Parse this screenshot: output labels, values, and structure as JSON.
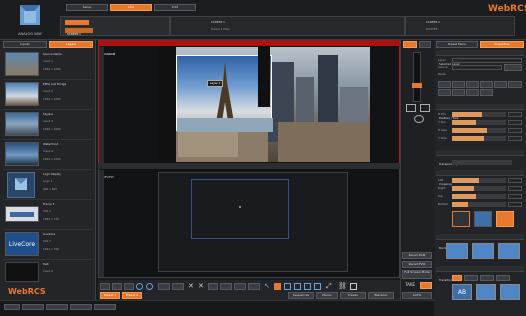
{
  "topbar": {
    "tabs": [
      {
        "label": "Setup"
      },
      {
        "label": "Live"
      },
      {
        "label": "Edit"
      }
    ],
    "left_items": [
      {
        "label": "SCREEN 1"
      },
      {
        "label": "MONITORING"
      }
    ],
    "mid_items": [
      {
        "label": "SCREEN 1"
      },
      {
        "label": "Preset 1 Main"
      }
    ],
    "right_items": [
      {
        "label": "SCREEN 2"
      },
      {
        "label": "MASTER"
      }
    ],
    "brand": "WebRCS",
    "logo": "ANALOG WAY"
  },
  "left": {
    "tabs": [
      {
        "label": "Inputs"
      },
      {
        "label": "Layers"
      }
    ],
    "items": [
      {
        "title": "Source Name",
        "sub": "Input 1",
        "res": "1920 x 1080"
      },
      {
        "title": "Eiffel and Bridge",
        "sub": "Input 2",
        "res": "1920 x 1080"
      },
      {
        "title": "Skyline",
        "sub": "Input 3",
        "res": "1920 x 1080"
      },
      {
        "title": "Waterfront",
        "sub": "Input 4",
        "res": "1920 x 1080"
      },
      {
        "title": "Logo Display",
        "sub": "Logo 1",
        "res": "800 x 600"
      },
      {
        "title": "Frame 3",
        "sub": "Still 1",
        "res": "1280 x 720"
      },
      {
        "title": "LiveCore",
        "sub": "Still 2",
        "res": "1024 x 768"
      },
      {
        "title": "Text",
        "sub": "Input 6",
        "res": "1920 x 1080"
      }
    ],
    "brand": "WebRCS"
  },
  "program": {
    "label": "PROGRAM",
    "layer_label": "Layer 1"
  },
  "preview": {
    "label": "PREVIEW"
  },
  "right": {
    "tabs": [
      {
        "label": "Preset Menu"
      },
      {
        "label": "Properties"
      }
    ],
    "sections": [
      {
        "title": "Selected Layer"
      },
      {
        "title": "Position / Size"
      },
      {
        "title": "Transparency"
      },
      {
        "title": "Cropping"
      },
      {
        "title": "Border"
      },
      {
        "title": "Transitions"
      }
    ],
    "fields": [
      {
        "label": "Layer"
      },
      {
        "label": "Source"
      },
      {
        "label": "Mode"
      }
    ],
    "pos": [
      {
        "label": "H Pos",
        "value": 0.55
      },
      {
        "label": "V Pos",
        "value": 0.45
      },
      {
        "label": "H Size",
        "value": 0.65
      },
      {
        "label": "V Size",
        "value": 0.6
      }
    ],
    "crop": [
      {
        "label": "Left",
        "value": 0.5
      },
      {
        "label": "Right",
        "value": 0.4
      },
      {
        "label": "Top",
        "value": 0.45
      },
      {
        "label": "Bottom",
        "value": 0.3
      }
    ]
  },
  "bottom": {
    "take_label": "TAKE",
    "auto_label": "AUTO",
    "actions": [
      "Preset 1",
      "Preset 2",
      "Sequences",
      "Memo",
      "Freeze",
      "Blackout",
      "Set Up"
    ],
    "side_buttons": [
      "Recall PGM",
      "Recall PVW",
      "Full Screen Mode"
    ]
  },
  "colors": {
    "accent": "#e8792c",
    "red": "#c01818",
    "panel": "#2b2d31",
    "brand_blue": "#2a78d8"
  }
}
